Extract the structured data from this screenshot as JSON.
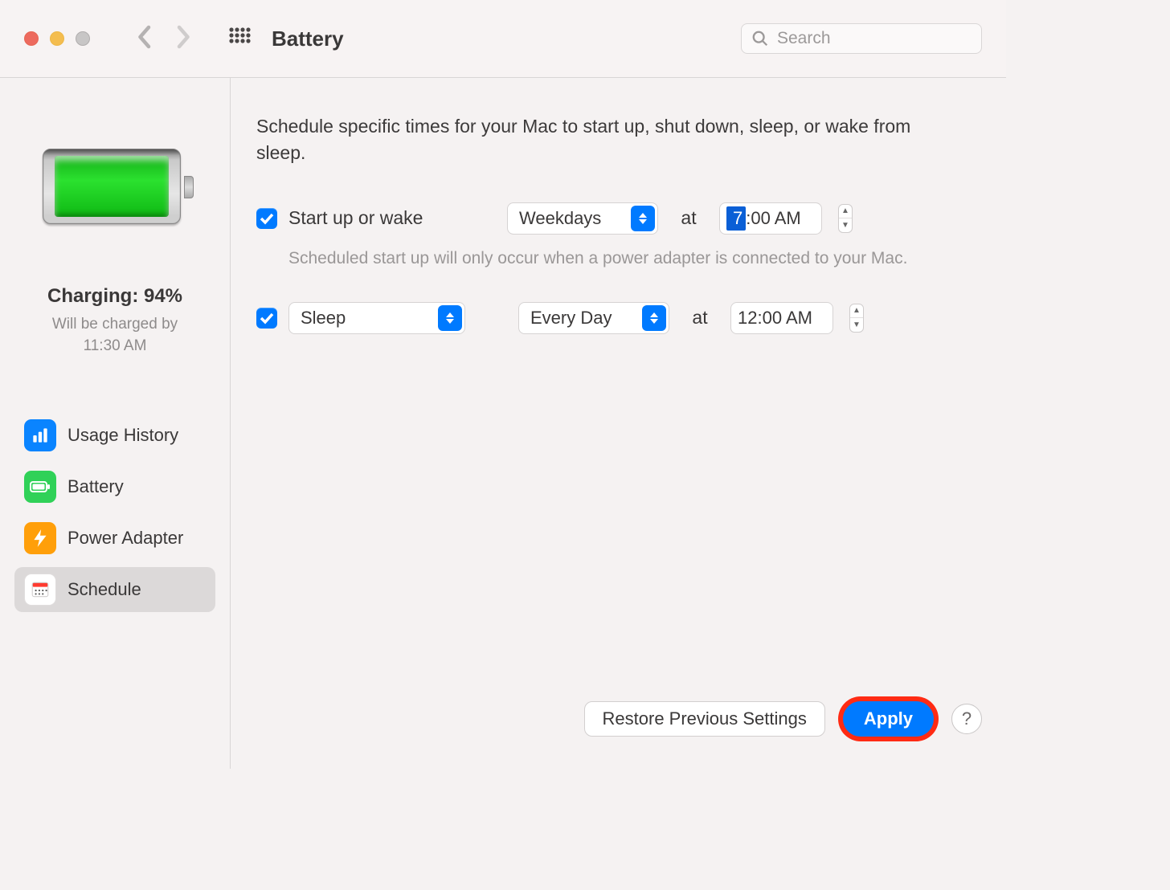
{
  "header": {
    "title": "Battery",
    "search_placeholder": "Search"
  },
  "sidebar": {
    "charging_label": "Charging: 94%",
    "charging_sub_line1": "Will be charged by",
    "charging_sub_line2": "11:30 AM",
    "items": [
      {
        "label": "Usage History",
        "icon": "usage-history-icon",
        "color": "#0a84ff"
      },
      {
        "label": "Battery",
        "icon": "battery-icon",
        "color": "#30d158"
      },
      {
        "label": "Power Adapter",
        "icon": "power-adapter-icon",
        "color": "#ff9f0a"
      },
      {
        "label": "Schedule",
        "icon": "schedule-icon",
        "color": "#ffffff",
        "selected": true
      }
    ]
  },
  "main": {
    "intro": "Schedule specific times for your Mac to start up, shut down, sleep, or wake from sleep.",
    "startup": {
      "checked": true,
      "label": "Start up or wake",
      "day_option": "Weekdays",
      "at_label": "at",
      "time_display": "7:00 AM",
      "time_selected_part": "7",
      "time_rest": ":00 AM",
      "hint": "Scheduled start up will only occur when a power adapter is connected to your Mac."
    },
    "shutdown": {
      "checked": true,
      "action_option": "Sleep",
      "day_option": "Every Day",
      "at_label": "at",
      "time_display": "12:00 AM"
    },
    "buttons": {
      "restore": "Restore Previous Settings",
      "apply": "Apply",
      "help": "?"
    }
  },
  "colors": {
    "accent": "#007aff",
    "highlight_ring": "#ff2b14"
  }
}
